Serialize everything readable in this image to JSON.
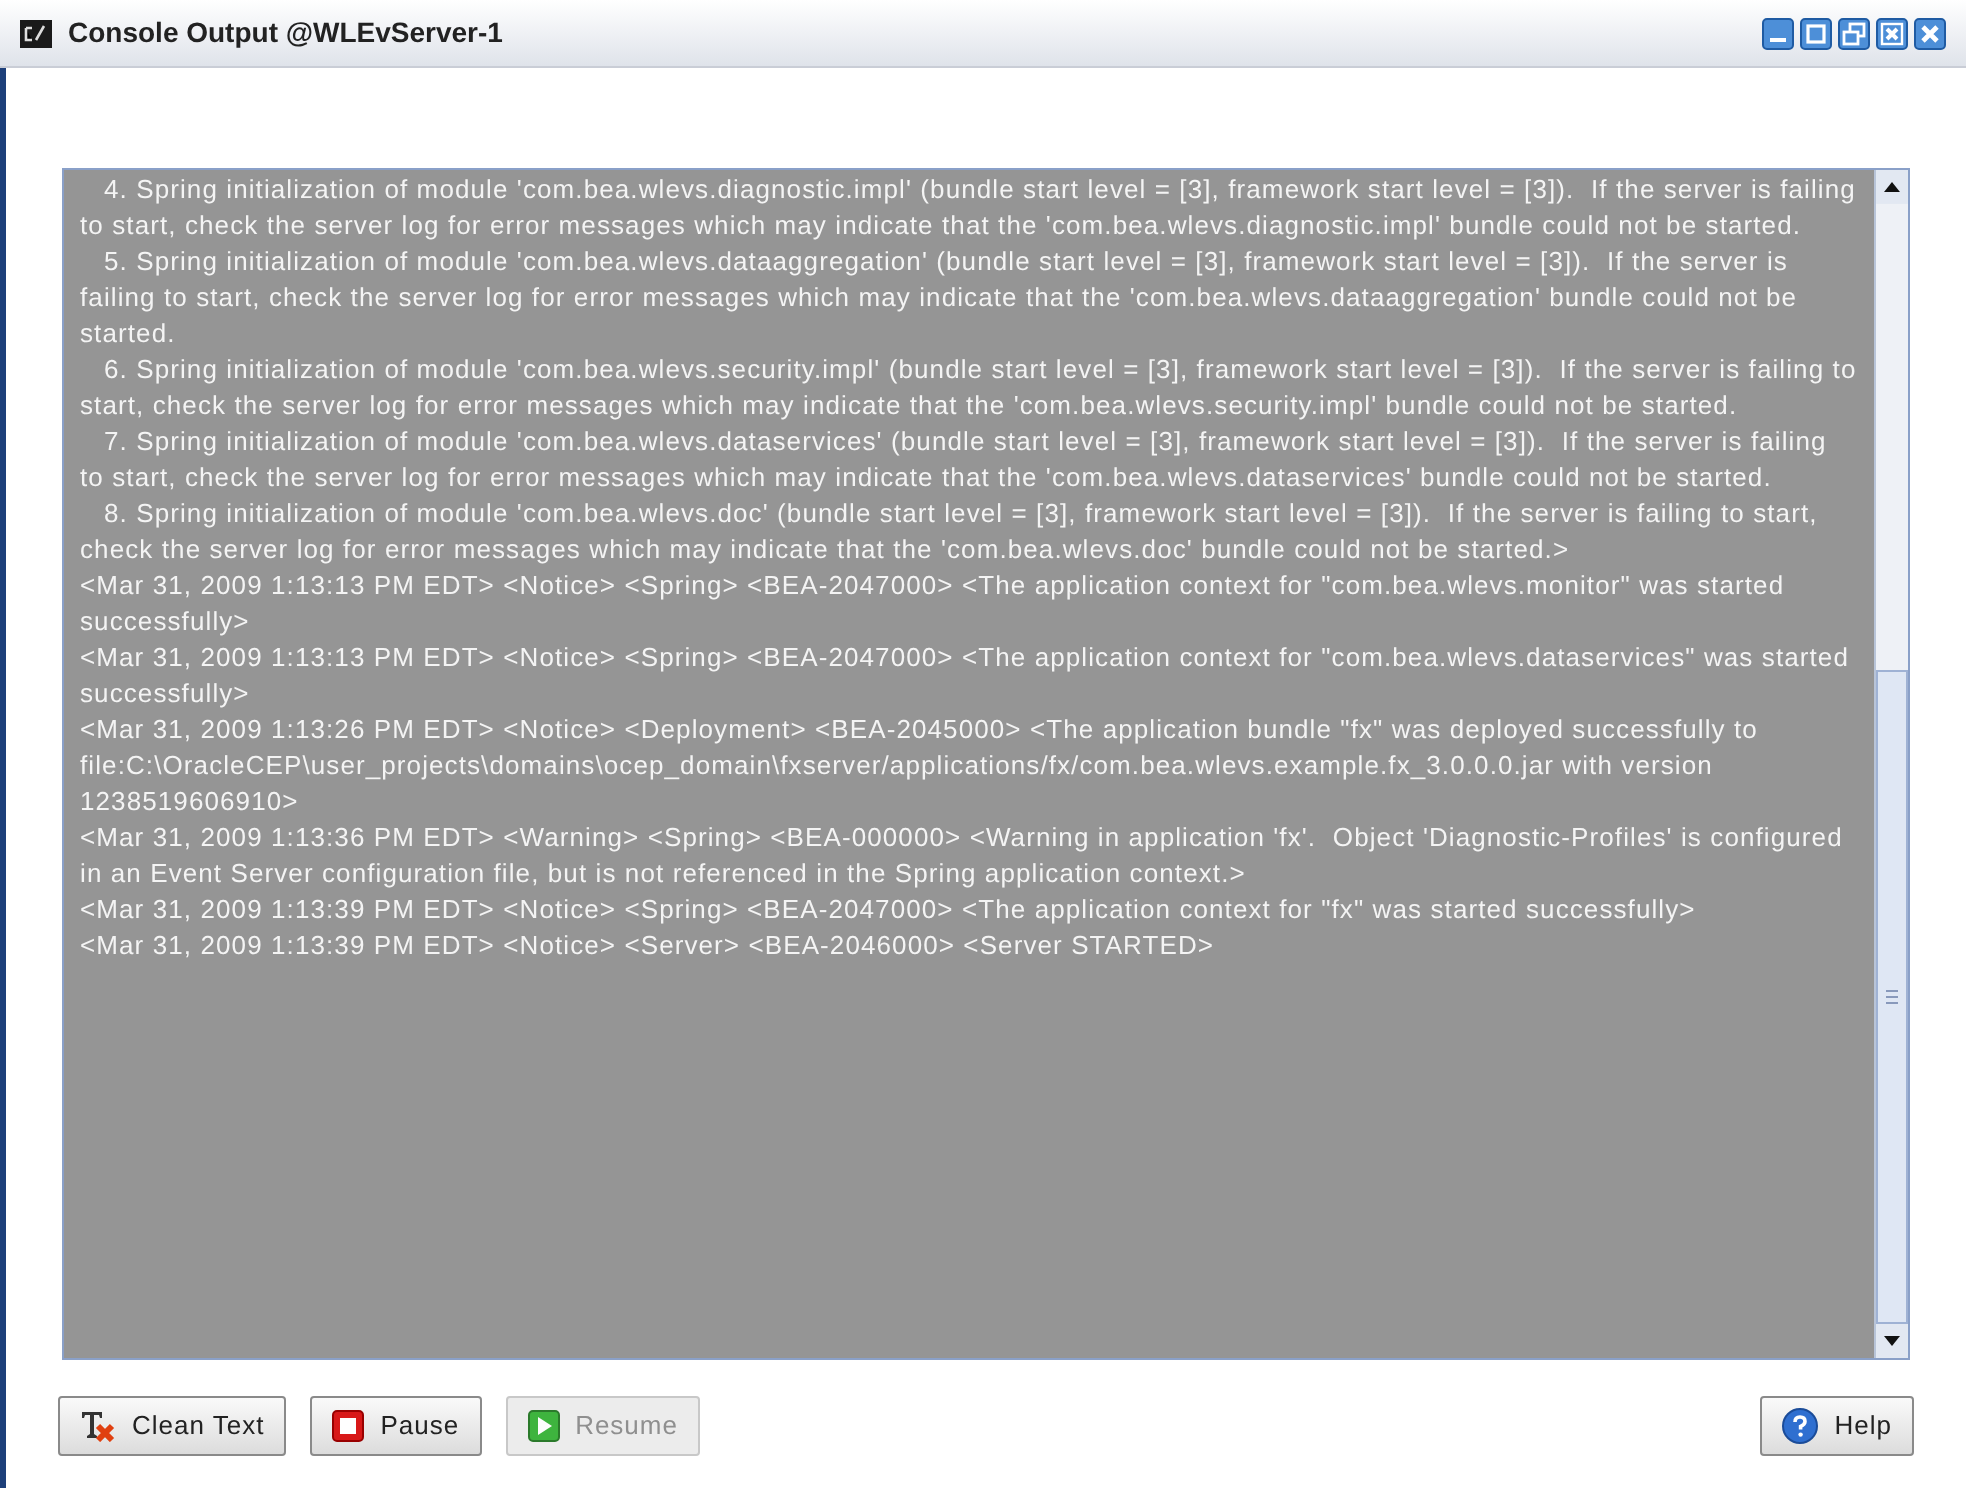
{
  "window": {
    "title": "Console Output @WLEvServer-1"
  },
  "console": {
    "entries": [
      {
        "kind": "step",
        "text": "4. Spring initialization of module 'com.bea.wlevs.diagnostic.impl' (bundle start level = [3], framework start level = [3]).  If the server is failing to start, check the server log for error messages which may indicate that the 'com.bea.wlevs.diagnostic.impl' bundle could not be started."
      },
      {
        "kind": "step",
        "text": "5. Spring initialization of module 'com.bea.wlevs.dataaggregation' (bundle start level = [3], framework start level = [3]).  If the server is failing to start, check the server log for error messages which may indicate that the 'com.bea.wlevs.dataaggregation' bundle could not be started."
      },
      {
        "kind": "step",
        "text": "6. Spring initialization of module 'com.bea.wlevs.security.impl' (bundle start level = [3], framework start level = [3]).  If the server is failing to start, check the server log for error messages which may indicate that the 'com.bea.wlevs.security.impl' bundle could not be started."
      },
      {
        "kind": "step",
        "text": "7. Spring initialization of module 'com.bea.wlevs.dataservices' (bundle start level = [3], framework start level = [3]).  If the server is failing to start, check the server log for error messages which may indicate that the 'com.bea.wlevs.dataservices' bundle could not be started."
      },
      {
        "kind": "step",
        "text": "8. Spring initialization of module 'com.bea.wlevs.doc' (bundle start level = [3], framework start level = [3]).  If the server is failing to start, check the server log for error messages which may indicate that the 'com.bea.wlevs.doc' bundle could not be started.>"
      },
      {
        "kind": "log",
        "text": "<Mar 31, 2009 1:13:13 PM EDT> <Notice> <Spring> <BEA-2047000> <The application context for \"com.bea.wlevs.monitor\" was started successfully>"
      },
      {
        "kind": "log",
        "text": "<Mar 31, 2009 1:13:13 PM EDT> <Notice> <Spring> <BEA-2047000> <The application context for \"com.bea.wlevs.dataservices\" was started successfully>"
      },
      {
        "kind": "log",
        "text": "<Mar 31, 2009 1:13:26 PM EDT> <Notice> <Deployment> <BEA-2045000> <The application bundle \"fx\" was deployed successfully to file:C:\\OracleCEP\\user_projects\\domains\\ocep_domain\\fxserver/applications/fx/com.bea.wlevs.example.fx_3.0.0.0.jar with version 1238519606910>"
      },
      {
        "kind": "log",
        "text": "<Mar 31, 2009 1:13:36 PM EDT> <Warning> <Spring> <BEA-000000> <Warning in application 'fx'.  Object 'Diagnostic-Profiles' is configured in an Event Server configuration file, but is not referenced in the Spring application context.>"
      },
      {
        "kind": "log",
        "text": "<Mar 31, 2009 1:13:39 PM EDT> <Notice> <Spring> <BEA-2047000> <The application context for \"fx\" was started successfully>"
      },
      {
        "kind": "log",
        "text": "<Mar 31, 2009 1:13:39 PM EDT> <Notice> <Server> <BEA-2046000> <Server STARTED>"
      }
    ]
  },
  "buttons": [
    {
      "kind": "clean",
      "label": "Clean Text",
      "disabled": false
    },
    {
      "kind": "pause",
      "label": "Pause",
      "disabled": false
    },
    {
      "kind": "resume",
      "label": "Resume",
      "disabled": true
    },
    {
      "kind": "help",
      "label": "Help",
      "disabled": false
    }
  ]
}
